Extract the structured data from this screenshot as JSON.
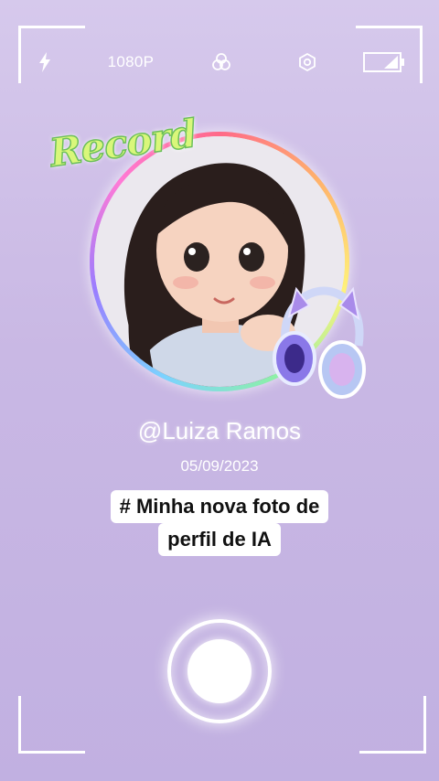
{
  "toolbar": {
    "flash_icon": "flash-icon",
    "resolution": "1080P",
    "filter_icon": "color-filter-icon",
    "settings_icon": "settings-icon",
    "battery_icon": "battery-icon"
  },
  "avatar": {
    "badge_text": "Record",
    "accessory_icon": "cat-ear-headphones-icon"
  },
  "profile": {
    "username": "@Luiza Ramos",
    "date": "05/09/2023",
    "caption_line1": "# Minha nova foto de",
    "caption_line2": "perfil de IA"
  },
  "colors": {
    "background_top": "#d6c9ec",
    "background_bottom": "#c1b0e1",
    "badge_fill": "#d9f77a",
    "caption_bg": "#ffffff"
  }
}
